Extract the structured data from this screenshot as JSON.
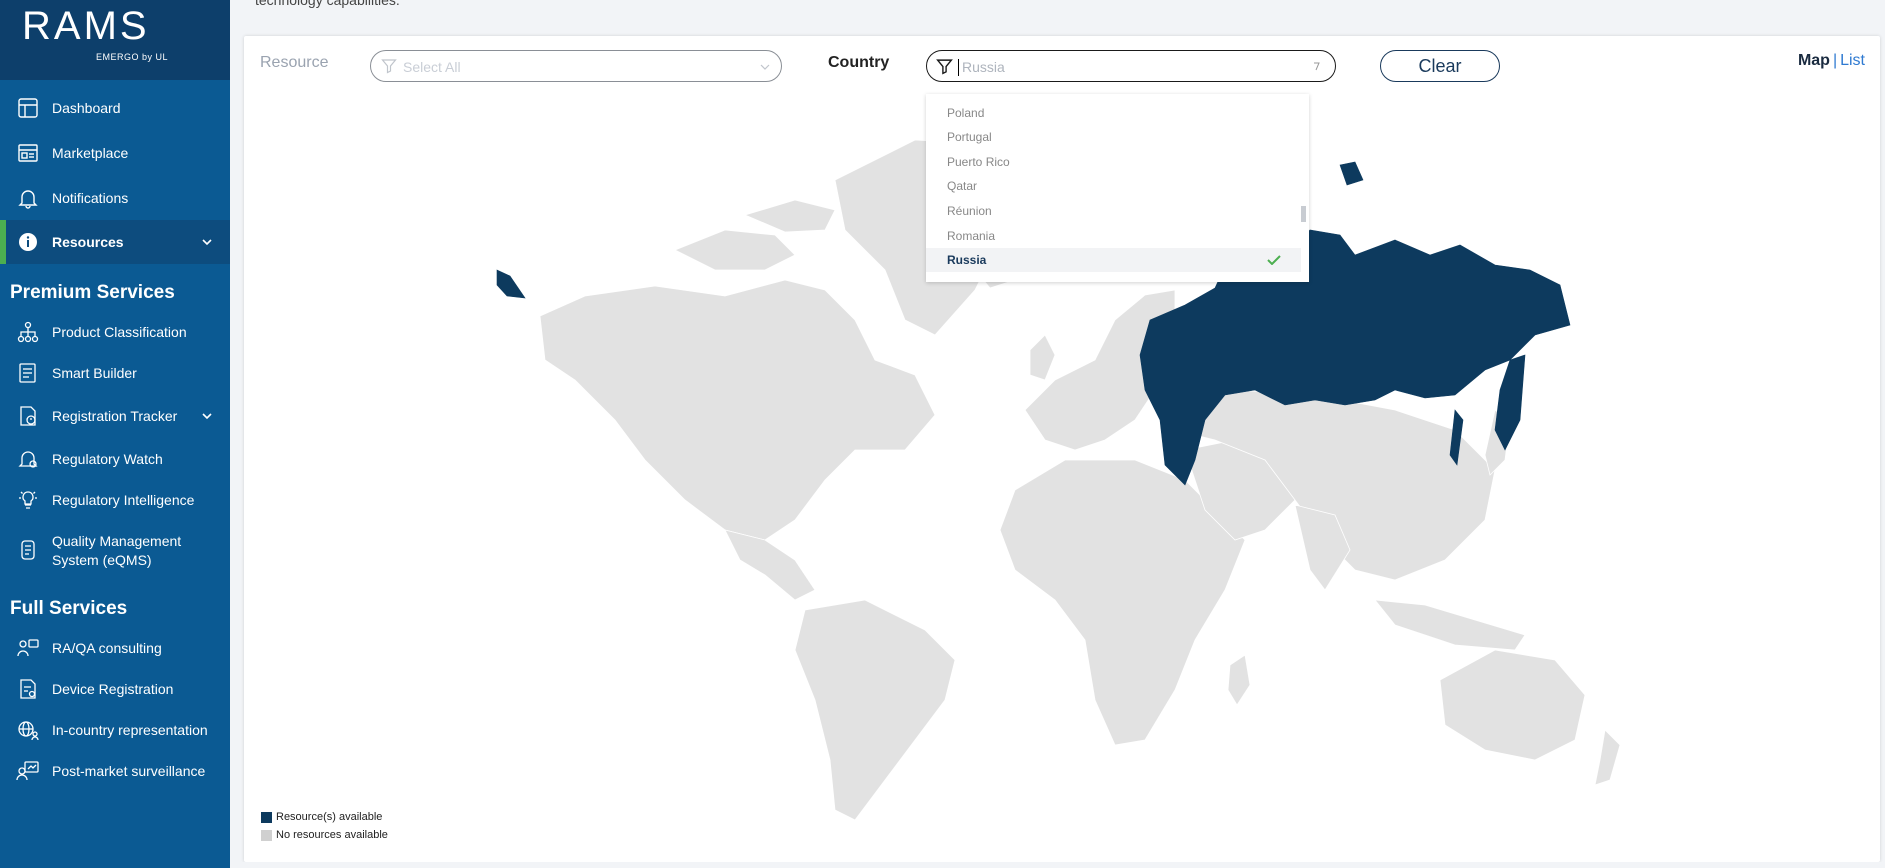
{
  "logo": {
    "text": "RAMS",
    "subtitle": "EMERGO by UL"
  },
  "sidebar": {
    "items": [
      {
        "label": "Dashboard",
        "icon": "dashboard-icon"
      },
      {
        "label": "Marketplace",
        "icon": "marketplace-icon"
      },
      {
        "label": "Notifications",
        "icon": "bell-icon"
      },
      {
        "label": "Resources",
        "icon": "info-icon",
        "active": true
      }
    ],
    "premium_title": "Premium Services",
    "premium_items": [
      {
        "label": "Product Classification",
        "icon": "hierarchy-icon"
      },
      {
        "label": "Smart Builder",
        "icon": "document-builder-icon"
      },
      {
        "label": "Registration Tracker",
        "icon": "tracker-icon"
      },
      {
        "label": "Regulatory Watch",
        "icon": "watch-bell-icon"
      },
      {
        "label": "Regulatory Intelligence",
        "icon": "lightbulb-icon"
      },
      {
        "label": "Quality Management",
        "label2": "System (eQMS)",
        "icon": "qms-icon"
      }
    ],
    "full_title": "Full Services",
    "full_items": [
      {
        "label": "RA/QA consulting",
        "icon": "consulting-icon"
      },
      {
        "label": "Device Registration",
        "icon": "registration-doc-icon"
      },
      {
        "label": "In-country representation",
        "icon": "globe-people-icon"
      },
      {
        "label": "Post-market surveillance",
        "icon": "surveillance-icon"
      }
    ]
  },
  "top_text": "technology capabilities.",
  "filters": {
    "resource_label": "Resource",
    "resource_placeholder": "Select All",
    "country_label": "Country",
    "country_value": "Russia",
    "clear_label": "Clear"
  },
  "view_toggle": {
    "map": "Map",
    "separator": "|",
    "list": "List"
  },
  "dropdown": {
    "options": [
      "Poland",
      "Portugal",
      "Puerto Rico",
      "Qatar",
      "Réunion",
      "Romania",
      "Russia"
    ],
    "selected": "Russia"
  },
  "legend": {
    "available": "Resource(s) available",
    "unavailable": "No resources available"
  },
  "colors": {
    "sidebar": "#0b5a93",
    "logo_bg": "#0d3f6b",
    "accent_green": "#4caf50",
    "available": "#0d3a5e",
    "unavailable": "#e2e2e2",
    "link": "#2f7ad1"
  }
}
